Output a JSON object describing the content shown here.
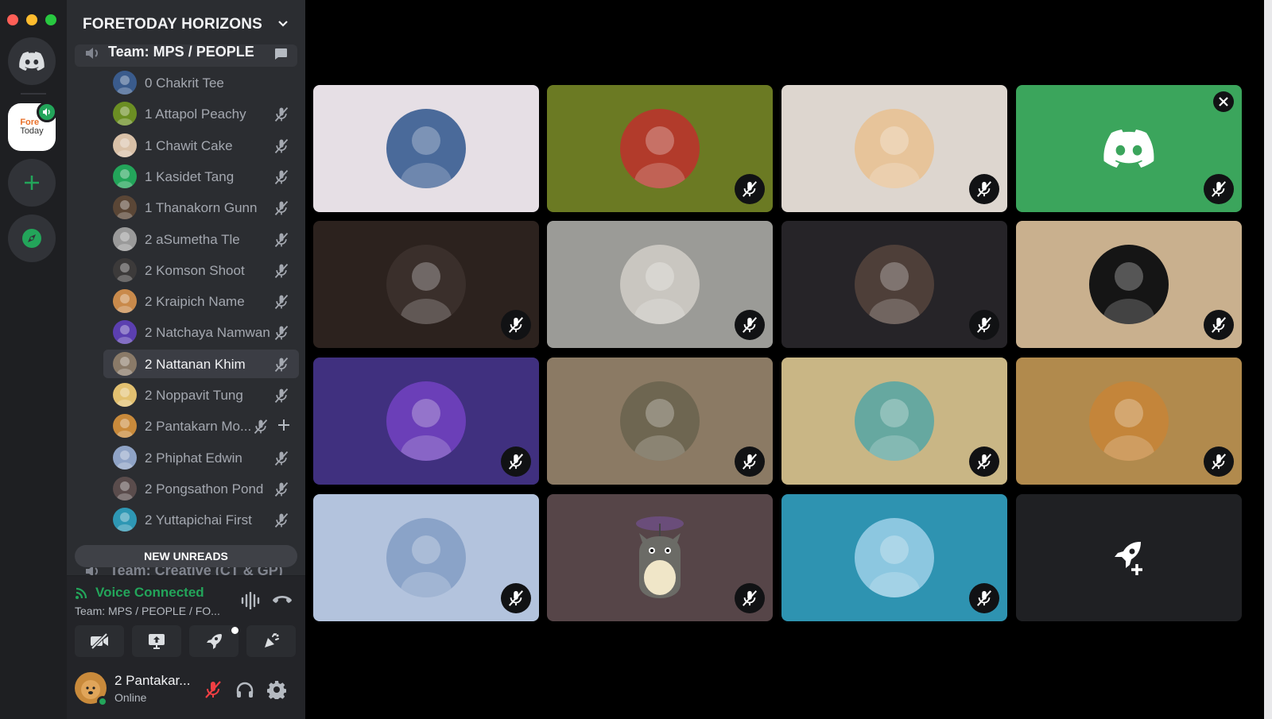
{
  "server": {
    "name": "FORETODAY HORIZONS",
    "logo_text": "Fore",
    "logo_sub": "Today"
  },
  "current_channel": {
    "name": "Team: MPS / PEOPLE"
  },
  "members": [
    {
      "name": "0 Chakrit Tee",
      "color": "#3a5b8c",
      "muted": false
    },
    {
      "name": "1 Attapol Peachy",
      "color": "#6b8e23",
      "muted": true
    },
    {
      "name": "1 Chawit Cake",
      "color": "#d9c1a8",
      "muted": true
    },
    {
      "name": "1 Kasidet Tang",
      "color": "#23a55a",
      "muted": true
    },
    {
      "name": "1 Thanakorn Gunn",
      "color": "#5a4636",
      "muted": true
    },
    {
      "name": "2 aSumetha Tle",
      "color": "#9a9a9a",
      "muted": true
    },
    {
      "name": "2 Komson Shoot",
      "color": "#3c3a3a",
      "muted": true
    },
    {
      "name": "2 Kraipich Name",
      "color": "#c98a4b",
      "muted": true
    },
    {
      "name": "2 Natchaya Namwan",
      "color": "#5b3fb0",
      "muted": true
    },
    {
      "name": "2 Nattanan Khim",
      "color": "#8a7a68",
      "muted": true
    },
    {
      "name": "2 Noppavit Tung",
      "color": "#e2c070",
      "muted": true
    },
    {
      "name": "2 Pantakarn Mo...",
      "color": "#c98a3b",
      "muted": true
    },
    {
      "name": "2 Phiphat Edwin",
      "color": "#8fa3c6",
      "muted": true
    },
    {
      "name": "2 Pongsathon Pond",
      "color": "#5a4c4c",
      "muted": true
    },
    {
      "name": "2 Yuttapichai First",
      "color": "#2e97b4",
      "muted": true
    }
  ],
  "new_unreads_label": "NEW UNREADS",
  "next_channel": {
    "name": "Team: Creative (CT & GP)"
  },
  "voice": {
    "status": "Voice Connected",
    "channel": "Team: MPS / PEOPLE / FO..."
  },
  "user": {
    "name": "2 Pantakar...",
    "status": "Online"
  },
  "tiles": [
    {
      "bg": "#e6dfe5",
      "avatar": "#4a6a9a",
      "muted": false,
      "close": false
    },
    {
      "bg": "#6b7a23",
      "avatar": "#b23b2b",
      "muted": true,
      "close": false
    },
    {
      "bg": "#ddd6cf",
      "avatar": "#e7c49a",
      "muted": true,
      "close": false
    },
    {
      "bg": "#3ba55c",
      "avatar": null,
      "muted": true,
      "close": true
    },
    {
      "bg": "#2c221e",
      "avatar": "#3a2f2b",
      "muted": true,
      "close": false
    },
    {
      "bg": "#9b9b97",
      "avatar": "#c9c6c0",
      "muted": true,
      "close": false
    },
    {
      "bg": "#262428",
      "avatar": "#4e3f39",
      "muted": true,
      "close": false
    },
    {
      "bg": "#c9b08e",
      "avatar": "#151515",
      "muted": true,
      "close": false
    },
    {
      "bg": "#40307f",
      "avatar": "#6b3fb8",
      "muted": true,
      "close": false
    },
    {
      "bg": "#8b7a64",
      "avatar": "#6e6651",
      "muted": true,
      "close": false
    },
    {
      "bg": "#c9b685",
      "avatar": "#66a8a0",
      "muted": true,
      "close": false
    },
    {
      "bg": "#b18a4d",
      "avatar": "#c4853a",
      "muted": true,
      "close": false
    },
    {
      "bg": "#b3c3dd",
      "avatar": "#8aa3c8",
      "muted": true,
      "close": false
    },
    {
      "bg": "#564548",
      "avatar": null,
      "muted": true,
      "close": false
    },
    {
      "bg": "#2e93b1",
      "avatar": "#8cc7e0",
      "muted": true,
      "close": false
    },
    {
      "bg": "#1f2023",
      "avatar": null,
      "muted": false,
      "close": false,
      "activity": true
    }
  ]
}
